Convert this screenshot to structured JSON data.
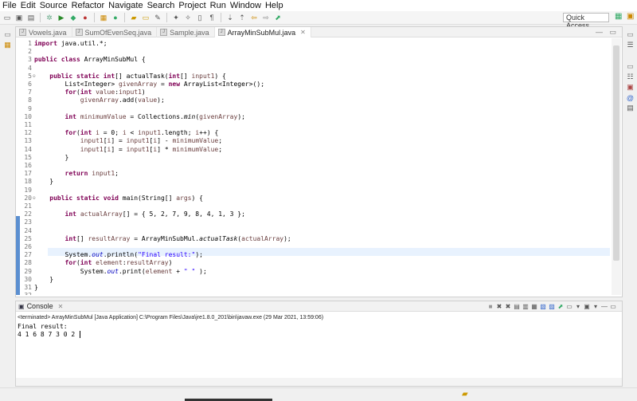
{
  "menu": [
    "File",
    "Edit",
    "Source",
    "Refactor",
    "Navigate",
    "Search",
    "Project",
    "Run",
    "Window",
    "Help"
  ],
  "toolbar": {
    "quick_access_label": "Quick Access"
  },
  "editor": {
    "tabs": [
      {
        "label": "Vowels.java",
        "active": false
      },
      {
        "label": "SumOfEvenSeq.java",
        "active": false
      },
      {
        "label": "Sample.java",
        "active": false
      },
      {
        "label": "ArrayMinSubMul.java",
        "active": true
      }
    ],
    "lines": [
      {
        "n": "1",
        "h": "<span class=\"kw\">import</span> java.util.*;"
      },
      {
        "n": "2",
        "h": ""
      },
      {
        "n": "3",
        "h": "<span class=\"kw\">public class</span> ArrayMinSubMul {"
      },
      {
        "n": "4",
        "h": ""
      },
      {
        "n": "5",
        "fold": "⊖",
        "h": "    <span class=\"kw\">public static int</span>[] actualTask(<span class=\"kw\">int</span>[] <span class=\"vr\">input1</span>) {"
      },
      {
        "n": "6",
        "h": "        List&lt;Integer&gt; <span class=\"vr\">givenArray</span> = <span class=\"kw\">new</span> ArrayList&lt;Integer&gt;();"
      },
      {
        "n": "7",
        "h": "        <span class=\"kw\">for</span>(<span class=\"kw\">int</span> <span class=\"vr\">value</span>:<span class=\"vr\">input1</span>)"
      },
      {
        "n": "8",
        "h": "            <span class=\"vr\">givenArray</span>.add(<span class=\"vr\">value</span>);"
      },
      {
        "n": "9",
        "h": ""
      },
      {
        "n": "10",
        "h": "        <span class=\"kw\">int</span> <span class=\"vr\">minimumValue</span> = Collections.<span class=\"it\">min</span>(<span class=\"vr\">givenArray</span>);"
      },
      {
        "n": "11",
        "h": ""
      },
      {
        "n": "12",
        "h": "        <span class=\"kw\">for</span>(<span class=\"kw\">int</span> <span class=\"vr\">i</span> = 0; <span class=\"vr\">i</span> &lt; <span class=\"vr\">input1</span>.length; <span class=\"vr\">i</span>++) {"
      },
      {
        "n": "13",
        "h": "            <span class=\"vr\">input1</span>[<span class=\"vr\">i</span>] = <span class=\"vr\">input1</span>[<span class=\"vr\">i</span>] - <span class=\"vr\">minimumValue</span>;"
      },
      {
        "n": "14",
        "h": "            <span class=\"vr\">input1</span>[<span class=\"vr\">i</span>] = <span class=\"vr\">input1</span>[<span class=\"vr\">i</span>] * <span class=\"vr\">minimumValue</span>;"
      },
      {
        "n": "15",
        "h": "        }"
      },
      {
        "n": "16",
        "h": ""
      },
      {
        "n": "17",
        "h": "        <span class=\"kw\">return</span> <span class=\"vr\">input1</span>;"
      },
      {
        "n": "18",
        "h": "    }"
      },
      {
        "n": "19",
        "h": ""
      },
      {
        "n": "20",
        "fold": "⊖",
        "h": "    <span class=\"kw\">public static void</span> main(String[] <span class=\"vr\">args</span>) {"
      },
      {
        "n": "21",
        "h": ""
      },
      {
        "n": "22",
        "h": "        <span class=\"kw\">int</span> <span class=\"vr\">actualArray</span>[] = { 5, 2, 7, 9, 8, 4, 1, 3 };"
      },
      {
        "n": "23",
        "h": ""
      },
      {
        "n": "24",
        "h": ""
      },
      {
        "n": "25",
        "h": "        <span class=\"kw\">int</span>[] <span class=\"vr\">resultArray</span> = ArrayMinSubMul.<span class=\"it\">actualTask</span>(<span class=\"vr\">actualArray</span>);"
      },
      {
        "n": "26",
        "h": ""
      },
      {
        "n": "27",
        "h": "        System.<span class=\"fd\">out</span>.println(<span class=\"st\">\"Final result:\"</span>);"
      },
      {
        "n": "28",
        "h": "        <span class=\"kw\">for</span>(<span class=\"kw\">int</span> <span class=\"vr\">element</span>:<span class=\"vr\">resultArray</span>)"
      },
      {
        "n": "29",
        "h": "            System.<span class=\"fd\">out</span>.print(<span class=\"vr\">element</span> + <span class=\"st\">\" \"</span> );"
      },
      {
        "n": "30",
        "h": "    }"
      },
      {
        "n": "31",
        "h": "}"
      },
      {
        "n": "32",
        "h": ""
      }
    ]
  },
  "console": {
    "tab_label": "Console",
    "status": "<terminated> ArrayMinSubMul [Java Application] C:\\Program Files\\Java\\jre1.8.0_201\\bin\\javaw.exe (29 Mar 2021, 13:59:06)",
    "output_line1": "Final result:",
    "output_line2": "4 1 6 8 7 3 0 2 "
  }
}
